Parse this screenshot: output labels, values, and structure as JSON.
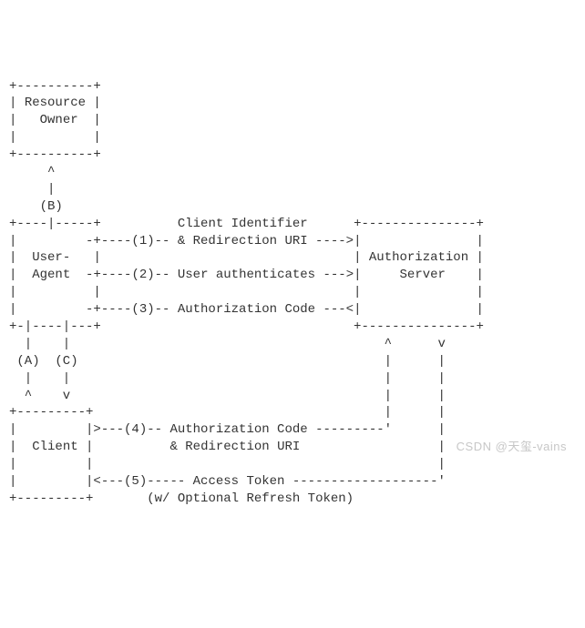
{
  "boxes": {
    "resource_owner_l1": "Resource",
    "resource_owner_l2": "Owner",
    "user_agent_l1": "User-",
    "user_agent_l2": "Agent",
    "authz_server_l1": "Authorization",
    "authz_server_l2": "Server",
    "client": "Client"
  },
  "header": {
    "client_identifier": "Client Identifier"
  },
  "steps": {
    "s1": "(1)-- & Redirection URI ---->",
    "s2": "(2)-- User authenticates --->",
    "s3": "(3)-- Authorization Code ---<",
    "s4": "(4)-- Authorization Code ---------'",
    "s4b": "& Redirection URI",
    "s5": "(5)----- Access Token -------------------'",
    "s5b": "(w/ Optional Refresh Token)"
  },
  "watermark": "CSDN @天玺-vains"
}
